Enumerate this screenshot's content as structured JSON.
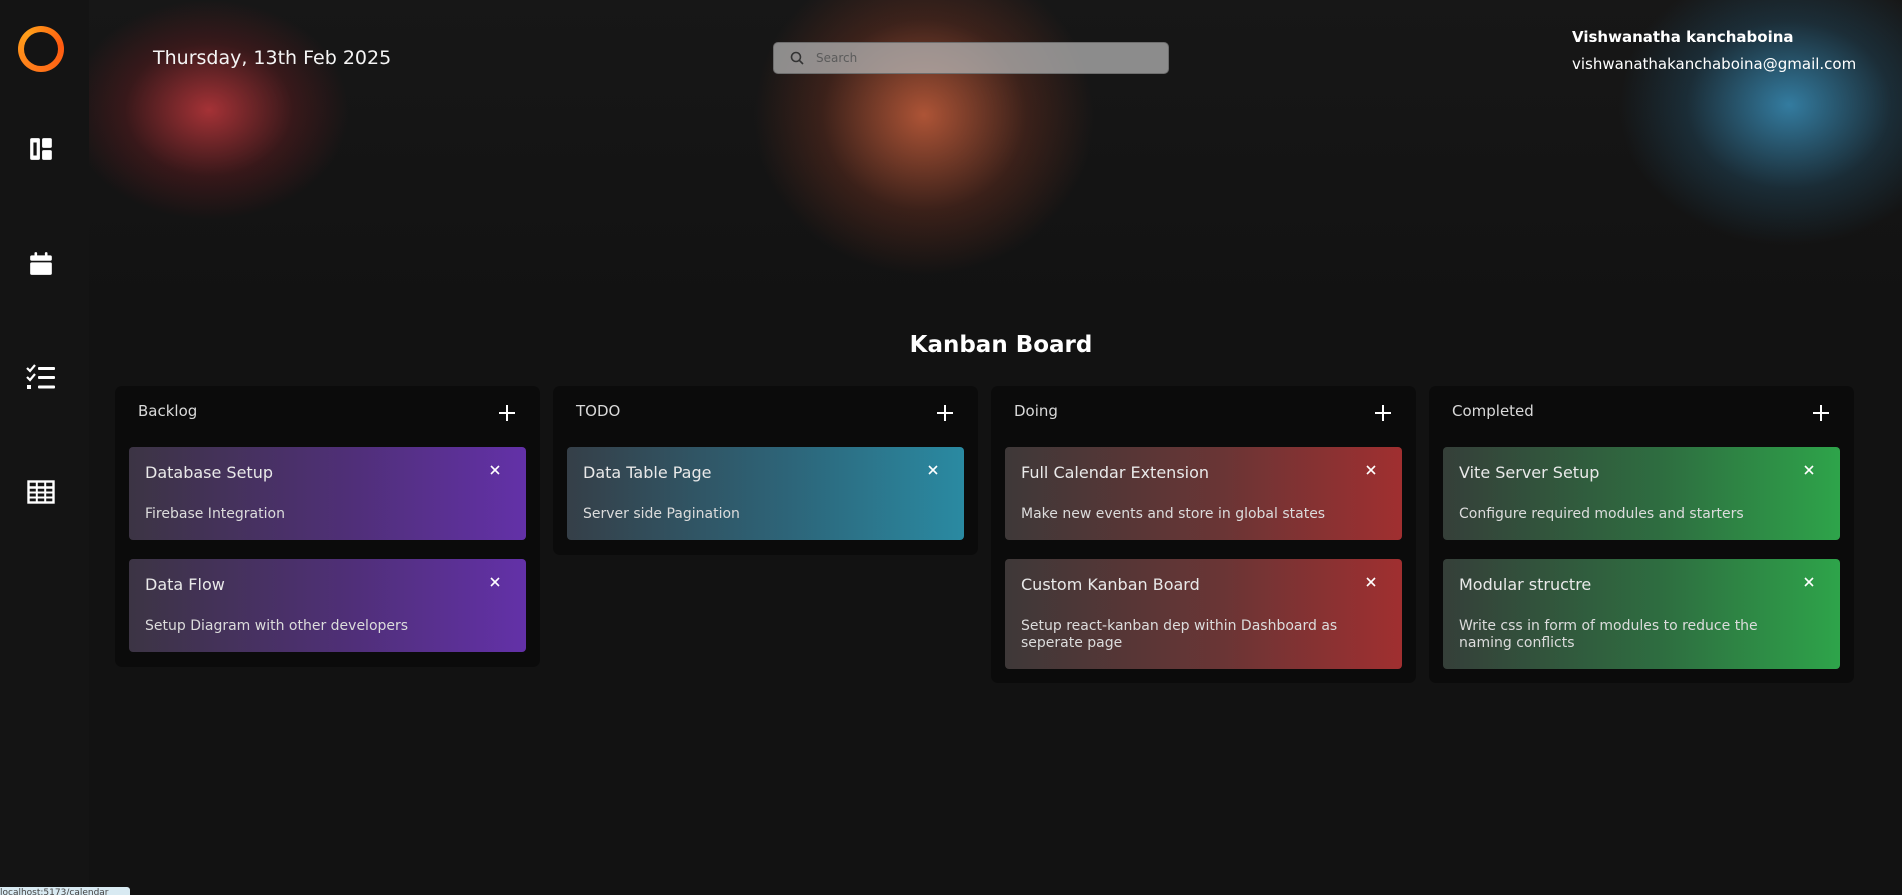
{
  "header": {
    "date": "Thursday, 13th Feb 2025",
    "search_placeholder": "Search",
    "user_name": "Vishwanatha kanchaboina",
    "user_email": "vishwanathakanchaboina@gmail.com"
  },
  "sidebar": {
    "items": [
      {
        "icon": "dashboard-icon"
      },
      {
        "icon": "calendar-icon"
      },
      {
        "icon": "checklist-icon"
      },
      {
        "icon": "table-grid-icon"
      }
    ]
  },
  "board": {
    "title": "Kanban Board",
    "columns": [
      {
        "title": "Backlog",
        "cards": [
          {
            "title": "Database Setup",
            "desc": "Firebase Integration",
            "color": "#6331a8"
          },
          {
            "title": "Data Flow",
            "desc": "Setup Diagram with other developers",
            "color": "#6331a8"
          }
        ]
      },
      {
        "title": "TODO",
        "cards": [
          {
            "title": "Data Table Page",
            "desc": "Server side Pagination",
            "color": "#2a8aa2"
          }
        ]
      },
      {
        "title": "Doing",
        "cards": [
          {
            "title": "Full Calendar Extension",
            "desc": "Make new events and store in global states",
            "color": "#a02f30"
          },
          {
            "title": "Custom Kanban Board",
            "desc": "Setup react-kanban dep within Dashboard as seperate page",
            "color": "#a02f30"
          }
        ]
      },
      {
        "title": "Completed",
        "cards": [
          {
            "title": "Vite Server Setup",
            "desc": "Configure required modules and starters",
            "color": "#2ea44a"
          },
          {
            "title": "Modular structre",
            "desc": "Write css in form of modules to reduce the naming conflicts",
            "color": "#2ea44a"
          }
        ]
      }
    ]
  },
  "status_bar": "localhost:5173/calendar"
}
